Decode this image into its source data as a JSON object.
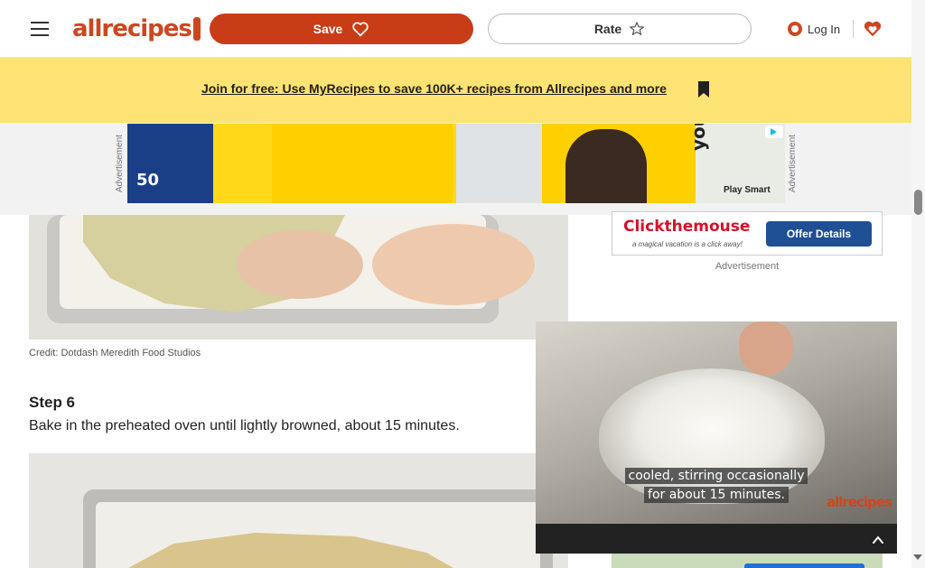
{
  "header": {
    "logo_text": "allrecipes",
    "save_label": "Save",
    "rate_label": "Rate",
    "login_label": "Log In"
  },
  "promo": {
    "link_text": "Join for free: Use MyRecipes to save 100K+ recipes from Allrecipes and more"
  },
  "ad_strip": {
    "left_label": "Advertisement",
    "right_label": "Advertisement",
    "banner": {
      "logo_text": "50",
      "tagline": "you",
      "sponsor": "Play Smart"
    }
  },
  "article": {
    "photo_credit": "Credit: Dotdash Meredith Food Studios",
    "step_title": "Step 6",
    "step_text": "Bake in the preheated oven until lightly browned, about 15 minutes."
  },
  "rail": {
    "ad_brand": "Clickthemouse",
    "ad_tagline": "a magical vacation is a click away!",
    "ad_button": "Offer Details",
    "ad_label": "Advertisement"
  },
  "video": {
    "caption_line1": "cooled, stirring occasionally",
    "caption_line2": "for about 15 minutes.",
    "watermark": "allrecipes"
  },
  "colors": {
    "brand": "#ce4620",
    "save_button": "#c83c17",
    "promo_bg": "#fce373"
  }
}
